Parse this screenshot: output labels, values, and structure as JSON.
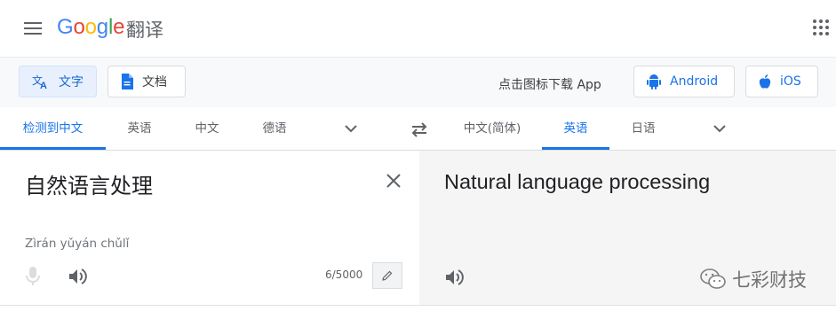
{
  "header": {
    "logo_parts": [
      "G",
      "o",
      "o",
      "g",
      "l",
      "e"
    ],
    "product": "翻译"
  },
  "toolbar": {
    "text_mode": "文字",
    "doc_mode": "文档",
    "promo": "点击图标下载 App",
    "android": "Android",
    "ios": "iOS"
  },
  "langbar": {
    "source_tabs": [
      "检测到中文",
      "英语",
      "中文",
      "德语"
    ],
    "target_tabs": [
      "中文(简体)",
      "英语",
      "日语"
    ],
    "active_source_index": 0,
    "active_target_index": 1
  },
  "source": {
    "text": "自然语言处理",
    "romanization": "Zìrán yǔyán chǔlǐ",
    "char_count": "6/5000"
  },
  "target": {
    "text": "Natural language processing"
  },
  "watermark": {
    "text": "七彩财技"
  },
  "colors": {
    "accent": "#1a73e8",
    "active_bg": "#e8f0fe",
    "target_bg": "#f5f5f5"
  }
}
